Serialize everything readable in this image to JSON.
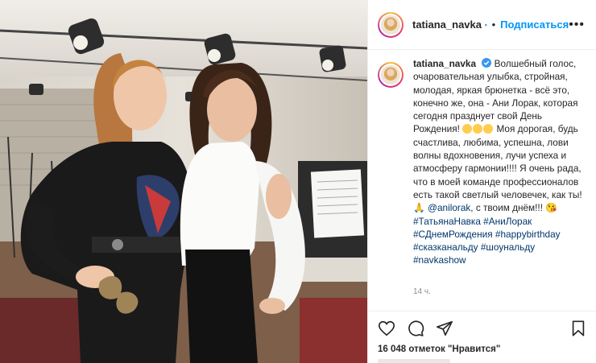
{
  "header": {
    "username": "tatiana_navka",
    "verified_icon": "verified-badge-icon",
    "separator": "•",
    "follow_label": "Подписаться",
    "more_label": "•••"
  },
  "caption": {
    "username": "tatiana_navka",
    "p1": "Волшебный голос, очаровательная улыбка, стройная, молодая, яркая брюнетка - всё это, конечно же, она - Ани Лорак, которая сегодня празднует свой День Рождения!",
    "p2": "Моя дорогая, будь счастлива, любима, успешна, лови волны вдохновения, лучи успеха и атмосферу гармонии!!!! Я очень рада, что в моей команде профессионалов есть такой светлый человечек, как ты!",
    "mention": "@anilorak",
    "p3": ", с твоим днём!!!",
    "hashtags": [
      "#ТатьянаНавка",
      "#АниЛорак",
      "#СДнемРождения",
      "#happybirthday",
      "#сказканальду",
      "#шоунальду",
      "#navkashow"
    ],
    "time": "14 ч."
  },
  "actions": {
    "like_icon": "heart-icon",
    "comment_icon": "comment-icon",
    "share_icon": "send-icon",
    "save_icon": "bookmark-icon"
  },
  "likes": {
    "count": "16 048",
    "text": "отметок \"Нравится\""
  },
  "colors": {
    "accent": "#0095f6",
    "text": "#262626",
    "hashtag": "#00376b",
    "muted": "#8e8e8e"
  }
}
